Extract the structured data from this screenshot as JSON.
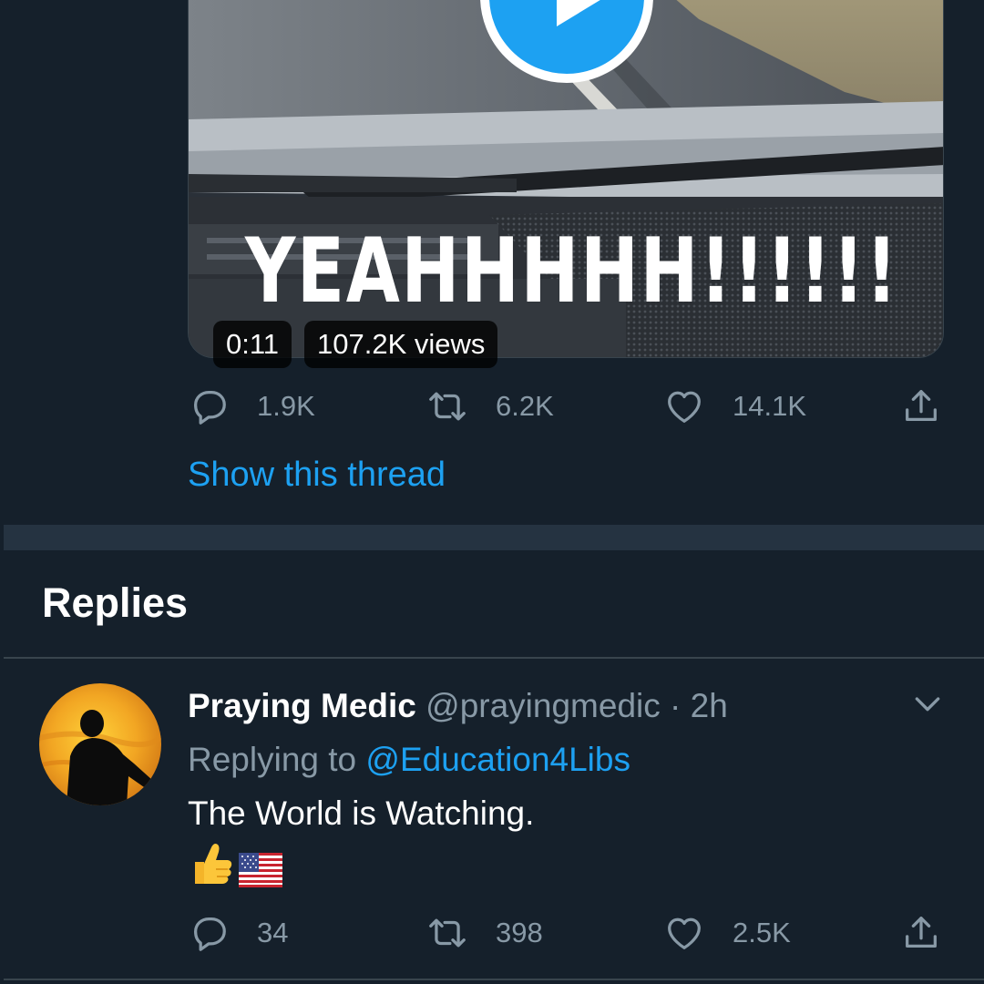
{
  "video": {
    "overlay_caption": "YEAHHHHH!!!!!!",
    "duration": "0:11",
    "views": "107.2K views"
  },
  "tweet_actions": {
    "replies": "1.9K",
    "retweets": "6.2K",
    "likes": "14.1K"
  },
  "thread_link": "Show this thread",
  "replies_heading": "Replies",
  "reply": {
    "name": "Praying Medic",
    "handle": "@prayingmedic",
    "separator": "·",
    "time": "2h",
    "replying_prefix": "Replying to",
    "replying_to": "@Education4Libs",
    "text": "The World is Watching.",
    "emojis": [
      "thumbs-up-emoji",
      "us-flag-emoji"
    ],
    "actions": {
      "replies": "34",
      "retweets": "398",
      "likes": "2.5K"
    }
  },
  "colors": {
    "background": "#15202b",
    "accent": "#1da1f2",
    "secondary_text": "#8899a6",
    "divider": "#253341"
  },
  "icons": [
    "play-icon",
    "reply-icon",
    "retweet-icon",
    "like-icon",
    "share-icon",
    "chevron-down-icon"
  ]
}
